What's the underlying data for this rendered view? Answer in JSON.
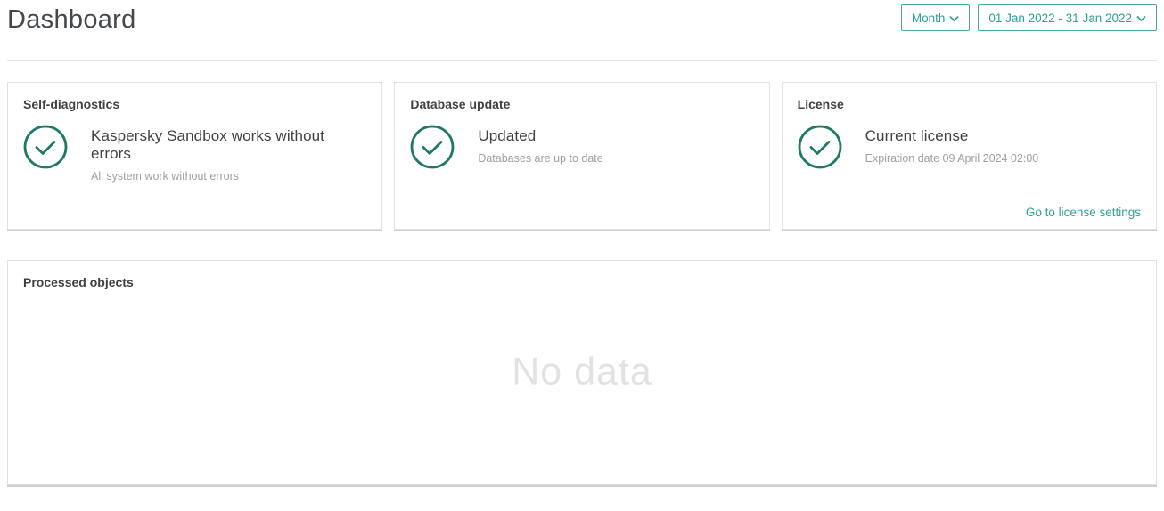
{
  "page": {
    "title": "Dashboard"
  },
  "colors": {
    "accent_teal": "#2EA096",
    "accent_border": "#47A79E",
    "check_green": "#1E7A67",
    "card_border": "#E1E1E1",
    "card_shadow": "#CFCFCF",
    "text_dark": "#3F4245",
    "text_muted": "#9DA0A2",
    "empty_text": "#E2E2E4"
  },
  "header": {
    "period_button": {
      "label": "Month",
      "icon": "chevron-down-icon"
    },
    "date_range_button": {
      "label": "01 Jan 2022 - 31 Jan 2022",
      "icon": "chevron-down-icon"
    }
  },
  "cards": [
    {
      "header": "Self-diagnostics",
      "icon": "check-circle-icon",
      "status_title": "Kaspersky Sandbox works without errors",
      "status_subtitle": "All system work without errors"
    },
    {
      "header": "Database update",
      "icon": "check-circle-icon",
      "status_title": "Updated",
      "status_subtitle": "Databases are up to date"
    },
    {
      "header": "License",
      "icon": "check-circle-icon",
      "status_title": "Current license",
      "status_subtitle": "Expiration date 09 April 2024 02:00",
      "link_label": "Go to license settings"
    }
  ],
  "processed_objects": {
    "header": "Processed objects",
    "empty_state": "No data"
  }
}
